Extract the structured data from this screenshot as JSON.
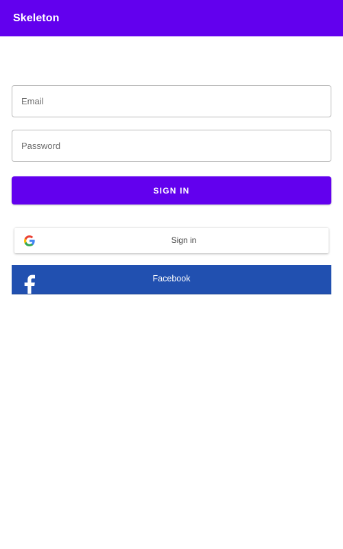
{
  "app_bar": {
    "title": "Skeleton",
    "color": "#6200ee"
  },
  "form": {
    "email_placeholder": "Email",
    "email_value": "",
    "password_placeholder": "Password",
    "password_value": "",
    "sign_in_label": "SIGN IN"
  },
  "social": {
    "google": {
      "label": "Sign in",
      "icon": "google-g-icon"
    },
    "facebook": {
      "label": "Facebook",
      "icon": "facebook-f-icon",
      "color": "#2150b0"
    }
  }
}
